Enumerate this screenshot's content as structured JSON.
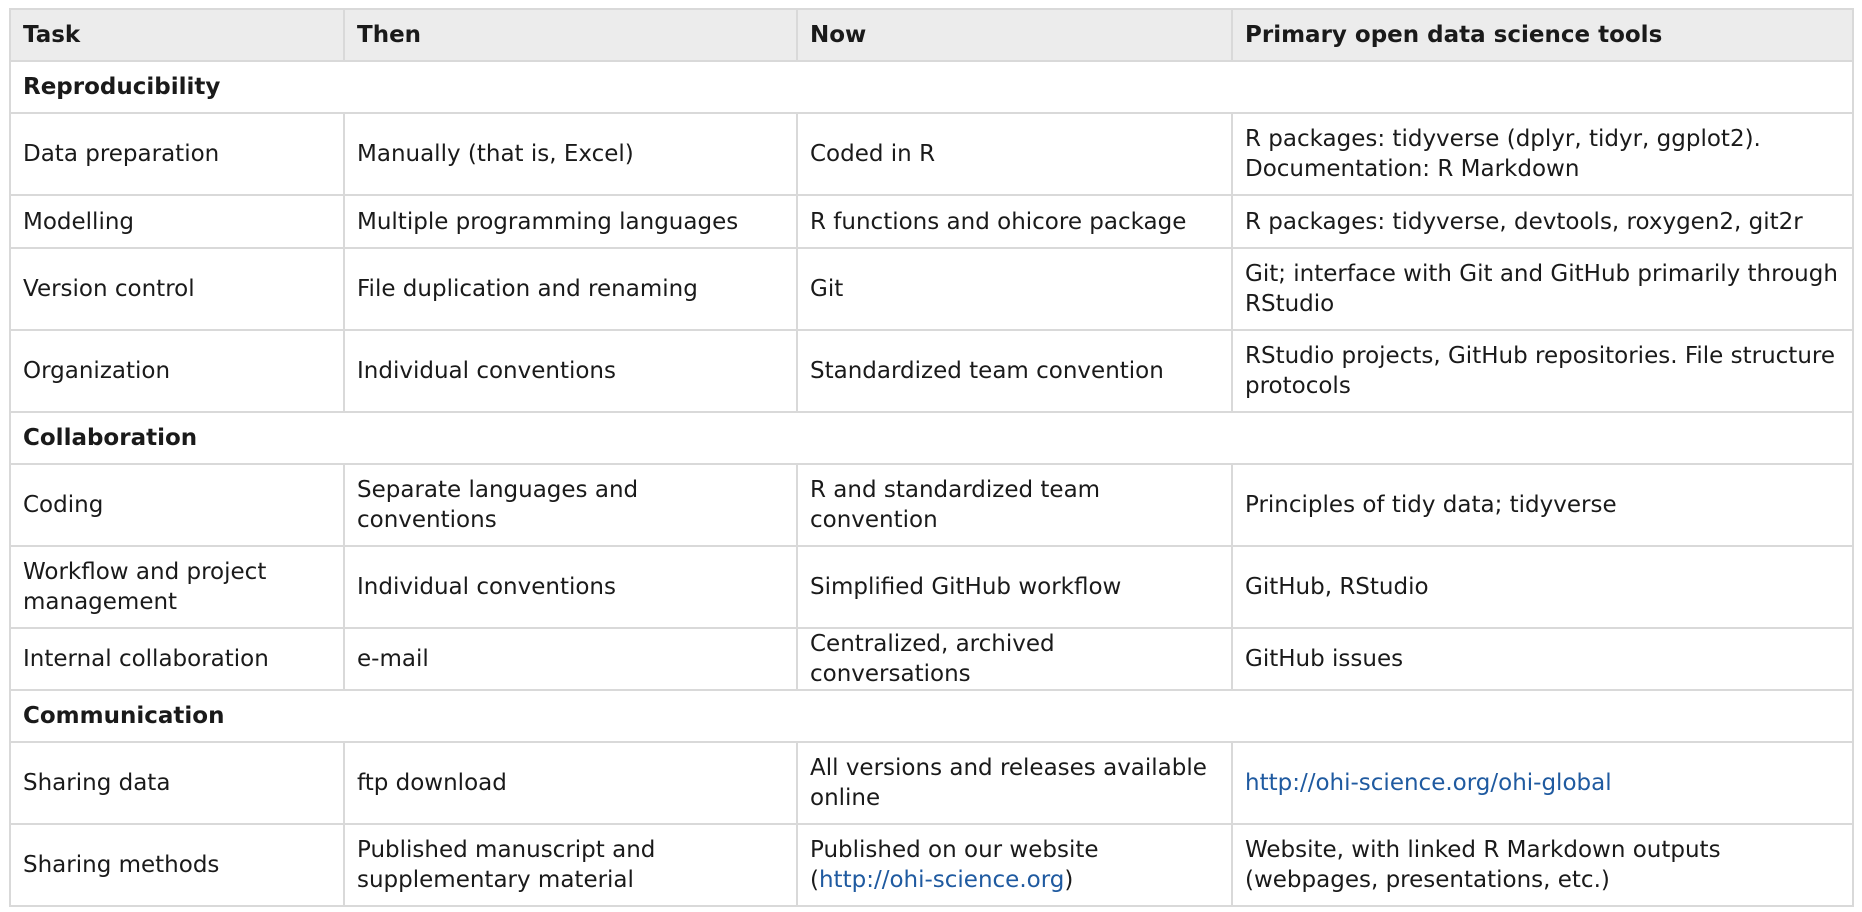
{
  "headers": [
    "Task",
    "Then",
    "Now",
    "Primary open data science tools"
  ],
  "sections": [
    {
      "title": "Reproducibility",
      "rows": [
        {
          "task": "Data preparation",
          "then": "Manually (that is, Excel)",
          "now": "Coded in R",
          "tools": [
            "R packages: tidyverse (dplyr, tidyr, ggplot2).",
            "Documentation: R Markdown"
          ]
        },
        {
          "task": "Modelling",
          "then": "Multiple programming languages",
          "now": "R functions and ohicore package",
          "tools": [
            "R packages: tidyverse, devtools, roxygen2, git2r"
          ]
        },
        {
          "task": "Version control",
          "then": "File duplication and renaming",
          "now": "Git",
          "tools": [
            "Git; interface with Git and GitHub primarily through",
            "RStudio"
          ]
        },
        {
          "task": "Organization",
          "then": "Individual conventions",
          "now": "Standardized team convention",
          "tools": [
            "RStudio projects, GitHub repositories. File structure",
            "protocols"
          ]
        }
      ]
    },
    {
      "title": "Collaboration",
      "rows": [
        {
          "task": "Coding",
          "then": "Separate languages and conventions",
          "now": [
            "R and standardized team",
            "convention"
          ],
          "tools": [
            "Principles of tidy data; tidyverse"
          ]
        },
        {
          "task": [
            "Workflow and project",
            "management"
          ],
          "then": "Individual conventions",
          "now": "Simplified GitHub workflow",
          "tools": [
            "GitHub, RStudio"
          ]
        },
        {
          "task": "Internal collaboration",
          "then": "e-mail",
          "now": "Centralized, archived conversations",
          "tools": [
            "GitHub issues"
          ]
        }
      ]
    },
    {
      "title": "Communication",
      "rows": [
        {
          "task": "Sharing data",
          "then": "ftp download",
          "now": [
            "All versions and releases available",
            "online"
          ],
          "tools_link": "http://ohi-science.org/ohi-global"
        },
        {
          "task": "Sharing methods",
          "then": [
            "Published manuscript and",
            "supplementary material"
          ],
          "now": [
            "Published on our website",
            "(",
            "http://ohi-science.org",
            ")"
          ],
          "tools": [
            "Website, with linked R Markdown outputs",
            "(webpages, presentations, etc.)"
          ]
        }
      ]
    }
  ],
  "colors": {
    "header_bg": "#ececec",
    "border": "#d9d9d9",
    "link": "#1f5aa0"
  }
}
